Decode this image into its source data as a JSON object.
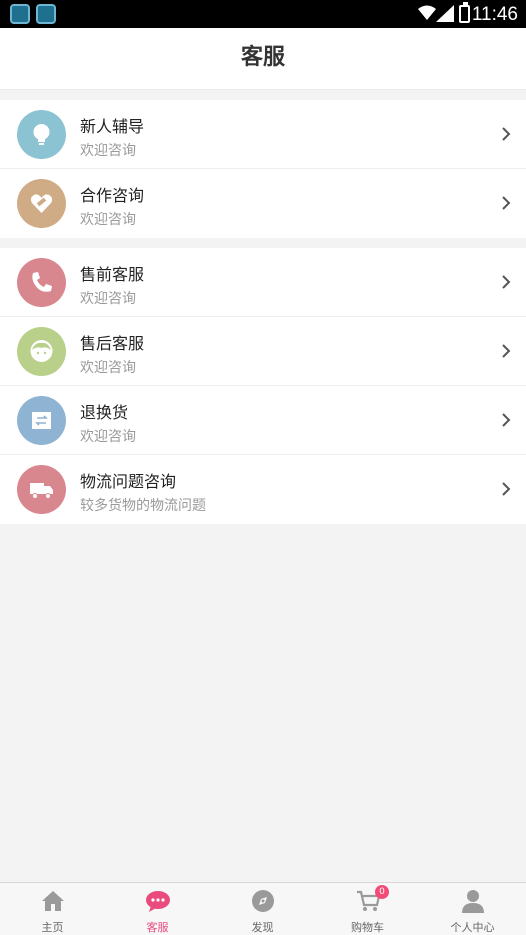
{
  "status_bar": {
    "time": "11:46"
  },
  "header": {
    "title": "客服"
  },
  "colors": {
    "accent": "#e94b7d",
    "guidance": "#8cc3d3",
    "cooperation": "#cfab86",
    "presale": "#d9878e",
    "aftersale": "#b8d08a",
    "returns": "#8fb3d3",
    "logistics": "#d9878e"
  },
  "groups": [
    {
      "items": [
        {
          "label": "新人辅导",
          "sub": "欢迎咨询",
          "icon": "lightbulb-icon"
        },
        {
          "label": "合作咨询",
          "sub": "欢迎咨询",
          "icon": "heart-tag-icon"
        }
      ]
    },
    {
      "items": [
        {
          "label": "售前客服",
          "sub": "欢迎咨询",
          "icon": "phone-icon"
        },
        {
          "label": "售后客服",
          "sub": "欢迎咨询",
          "icon": "agent-face-icon"
        },
        {
          "label": "退换货",
          "sub": "欢迎咨询",
          "icon": "exchange-icon"
        },
        {
          "label": "物流问题咨询",
          "sub": "较多货物的物流问题",
          "icon": "truck-icon"
        }
      ]
    }
  ],
  "tabbar": {
    "items": [
      {
        "label": "主页",
        "icon": "home-icon",
        "active": false
      },
      {
        "label": "客服",
        "icon": "chat-bubble-icon",
        "active": true
      },
      {
        "label": "发现",
        "icon": "compass-icon",
        "active": false
      },
      {
        "label": "购物车",
        "icon": "cart-icon",
        "active": false,
        "badge": "0"
      },
      {
        "label": "个人中心",
        "icon": "person-icon",
        "active": false
      }
    ]
  }
}
